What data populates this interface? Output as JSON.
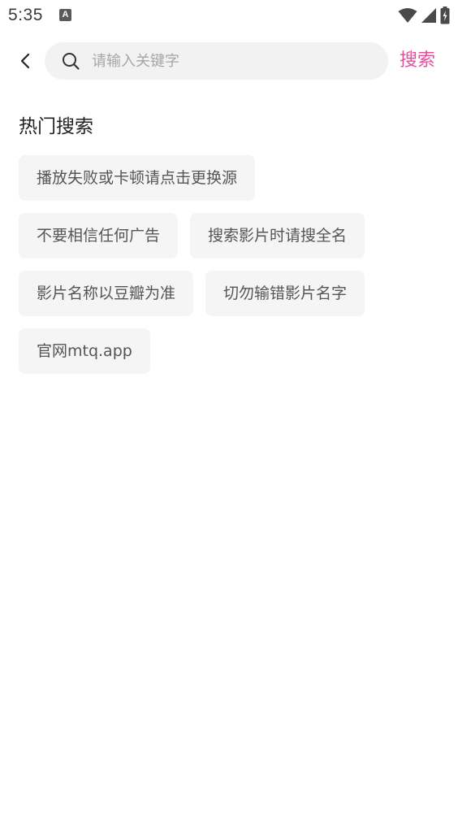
{
  "status_bar": {
    "time": "5:35",
    "notification_icon": "a-icon",
    "notification_letter": "A",
    "icons": [
      "wifi-icon",
      "cellular-signal-icon",
      "battery-charging-icon"
    ]
  },
  "header": {
    "back_icon": "chevron-left-icon",
    "search_icon": "search-icon",
    "search_placeholder": "请输入关键字",
    "search_value": "",
    "search_button_label": "搜索",
    "accent_color": "#e2509a"
  },
  "hot_search": {
    "title": "热门搜索",
    "rows": [
      [
        "播放失败或卡顿请点击更换源"
      ],
      [
        "不要相信任何广告",
        "搜索影片时请搜全名"
      ],
      [
        "影片名称以豆瓣为准",
        "切勿输错影片名字"
      ],
      [
        "官网mtq.app"
      ]
    ]
  }
}
